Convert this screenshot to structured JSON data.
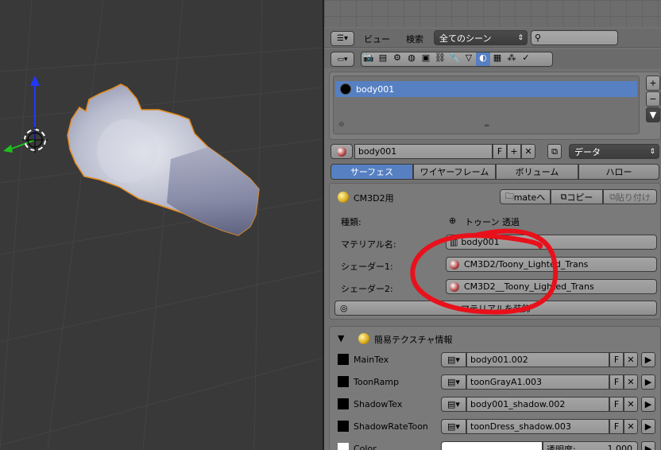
{
  "header": {
    "view_menu": "ビュー",
    "search_menu": "検索",
    "scene_select": "全てのシーン",
    "search_placeholder": ""
  },
  "material_slots": {
    "items": [
      {
        "name": "body001"
      }
    ]
  },
  "material": {
    "name": "body001",
    "fake_user": "F",
    "link_label": "データ"
  },
  "tabs": [
    {
      "label": "サーフェス"
    },
    {
      "label": "ワイヤーフレーム"
    },
    {
      "label": "ボリューム"
    },
    {
      "label": "ハロー"
    }
  ],
  "cm3d2": {
    "title": "CM3D2用",
    "mate_button": "mateへ",
    "copy_button": "コピー",
    "paste_button": "貼り付け",
    "type_label": "種類:",
    "type_value": "トゥーン 透過",
    "matname_label": "マテリアル名:",
    "matname_value": "body001",
    "shader1_label": "シェーダー1:",
    "shader1_value": "CM3D2/Toony_Lighted_Trans",
    "shader2_label": "シェーダー2:",
    "shader2_value": "CM3D2__Toony_Lighted_Trans",
    "decorate_button": "マテリアルを装飾"
  },
  "texture_panel": {
    "title": "簡易テクスチャ情報",
    "rows": [
      {
        "label": "MainTex",
        "value": "body001.002",
        "f": "F"
      },
      {
        "label": "ToonRamp",
        "value": "toonGrayA1.003",
        "f": "F"
      },
      {
        "label": "ShadowTex",
        "value": "body001_shadow.002",
        "f": "F"
      },
      {
        "label": "ShadowRateToon",
        "value": "toonDress_shadow.003",
        "f": "F"
      }
    ],
    "color_row": {
      "label": "Color",
      "alpha_label": "透明度:",
      "alpha_value": "1.000"
    }
  },
  "colors": {
    "selection": "#5680c2",
    "annotation": "#e8111b",
    "viewport_bg": "#393939"
  }
}
